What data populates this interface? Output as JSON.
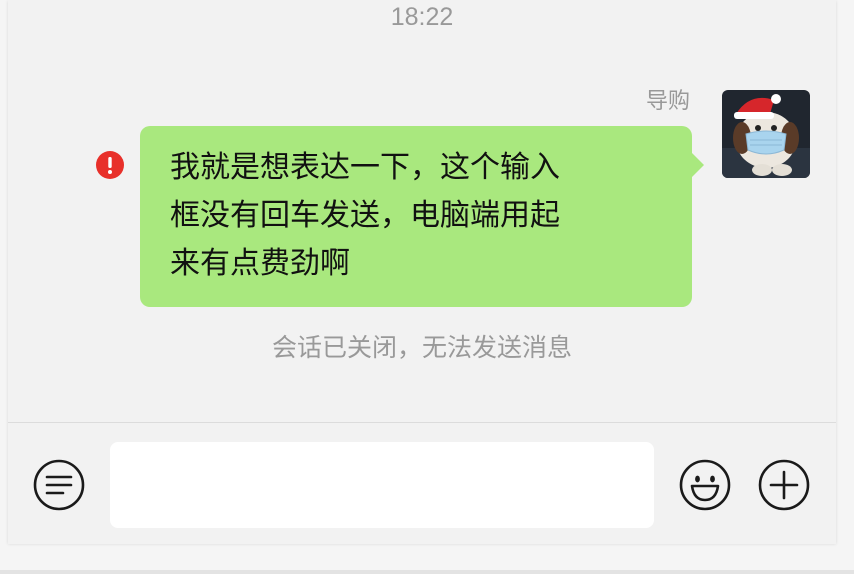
{
  "chat": {
    "timestamp": "18:22",
    "sender_name": "导购",
    "message_lines": [
      "我就是想表达一下，这个输入",
      "框没有回车发送，电脑端用起",
      "来有点费劲啊"
    ],
    "message_status": "error",
    "system_notice": "会话已关闭，无法发送消息"
  },
  "input_bar": {
    "message_value": "",
    "icons": [
      "menu-icon",
      "emoji-icon",
      "plus-icon"
    ]
  },
  "colors": {
    "bubble": "#a9e87e",
    "error": "#e8302a",
    "background": "#f2f2f2",
    "muted_text": "#999999"
  }
}
